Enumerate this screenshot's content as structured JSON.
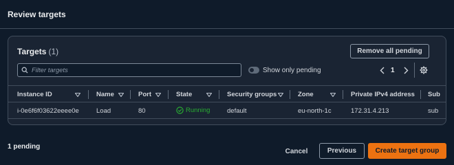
{
  "header": {
    "title": "Review targets"
  },
  "targets": {
    "title": "Targets",
    "count": "(1)",
    "remove_all_label": "Remove all pending",
    "filter_placeholder": "Filter targets",
    "show_only_pending_label": "Show only pending",
    "show_only_pending_on": false,
    "page_number": "1"
  },
  "table": {
    "columns": [
      "Instance ID",
      "Name",
      "Port",
      "State",
      "Security groups",
      "Zone",
      "Private IPv4 address",
      "Sub"
    ],
    "rows": [
      {
        "instance_id": "i-0e6f6f03622eeee0e",
        "name": "Load",
        "port": "80",
        "state": "Running",
        "security_groups": "default",
        "zone": "eu-north-1c",
        "private_ipv4": "172.31.4.213",
        "subnet": "sub"
      }
    ]
  },
  "footer": {
    "pending_text": "1 pending",
    "cancel_label": "Cancel",
    "previous_label": "Previous",
    "create_label": "Create target group"
  },
  "colors": {
    "background": "#0f1b2a",
    "panel": "#1a2433",
    "primary": "#ec7211",
    "running": "#29ad32"
  },
  "icons": {
    "search": "search-icon",
    "prev": "chevron-left-icon",
    "next": "chevron-right-icon",
    "settings": "gear-icon",
    "sort": "sort-caret-down-icon",
    "state": "check-circle-icon"
  }
}
